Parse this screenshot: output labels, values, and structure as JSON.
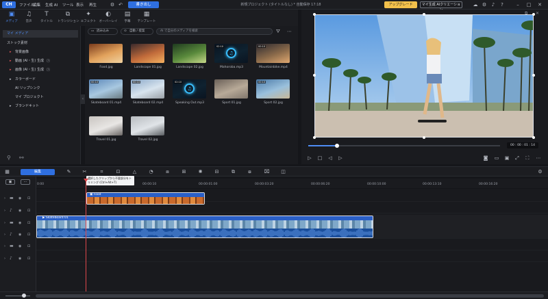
{
  "app": {
    "logo": "CH",
    "menus": [
      "ファイル",
      "編集",
      "生成 AI",
      "ツール",
      "表示",
      "再生"
    ],
    "export_label": "書き出し",
    "project_title": "新規プロジェクト (タイトルなし) * 自動保存 17:18",
    "upgrade_label": "アップグレード",
    "ai_label": "マイ生成 AIクリエーション"
  },
  "media_tabs": [
    {
      "label": "メディア",
      "icon": "media-icon",
      "glyph": "▣"
    },
    {
      "label": "音声",
      "icon": "music-icon",
      "glyph": "♫"
    },
    {
      "label": "タイトル",
      "icon": "title-icon",
      "glyph": "T"
    },
    {
      "label": "トランジション",
      "icon": "transition-icon",
      "glyph": "⧉"
    },
    {
      "label": "エフェクト",
      "icon": "effect-icon",
      "glyph": "✦"
    },
    {
      "label": "オーバーレイ",
      "icon": "overlay-icon",
      "glyph": "◐"
    },
    {
      "label": "字幕",
      "icon": "caption-icon",
      "glyph": "▤"
    },
    {
      "label": "テンプレート",
      "icon": "template-icon",
      "glyph": "▦"
    }
  ],
  "sidebar": {
    "items": [
      {
        "label": "マイ メディア",
        "active": true,
        "caret": false
      },
      {
        "label": "ストック素材",
        "active": false,
        "caret": false
      },
      {
        "label": "背景画像",
        "active": false,
        "caret": true
      },
      {
        "label": "動画 (AI・生) 生成",
        "active": false,
        "caret": true
      },
      {
        "label": "画像 (AI・生) 生成",
        "active": false,
        "caret": true
      },
      {
        "label": "カラーボード",
        "active": false,
        "caret": true
      },
      {
        "label": "AI リップシンク",
        "active": false,
        "caret": false
      },
      {
        "label": "マイ プロジェクト",
        "active": false,
        "caret": false
      },
      {
        "label": "ブランドキット",
        "active": false,
        "caret": true
      }
    ]
  },
  "filterbar": {
    "import_label": "読み込み",
    "download_label": "自動 / 提案",
    "search_placeholder": "AI で自分のメディアを検索"
  },
  "media_items": [
    {
      "label": "Food.jpg",
      "duration": "",
      "colors": [
        "#7a3b1c",
        "#e2a25c",
        "#f0d2a0"
      ]
    },
    {
      "label": "Landscape 01.jpg",
      "duration": "",
      "colors": [
        "#3a2a2c",
        "#c06a3a",
        "#f4b060"
      ]
    },
    {
      "label": "Landscape 02.jpg",
      "duration": "",
      "colors": [
        "#1f3b1f",
        "#5a8a3c",
        "#c7d98a"
      ]
    },
    {
      "label": "Mahoroba.mp3",
      "duration": "02:10",
      "colors": [
        "#0a1420",
        "#0f2230",
        "#0a1420"
      ],
      "music": true
    },
    {
      "label": "Mountainbike.mp4",
      "duration": "00:10",
      "colors": [
        "#2c2a30",
        "#8a6a4a",
        "#e0a870"
      ]
    },
    {
      "label": "Skateboard 01.mp4",
      "duration": "00:10",
      "colors": [
        "#5a86b8",
        "#a8c8e0",
        "#6a7a80"
      ]
    },
    {
      "label": "Skateboard 02.mp4",
      "duration": "00:10",
      "colors": [
        "#8aa8c8",
        "#d8e4ee",
        "#9aa0a6"
      ]
    },
    {
      "label": "Speaking Out.mp3",
      "duration": "02:10",
      "colors": [
        "#0a1420",
        "#0f2230",
        "#0a1420"
      ],
      "music": true
    },
    {
      "label": "Sport 01.jpg",
      "duration": "",
      "colors": [
        "#6a6058",
        "#b8aa98",
        "#80766c"
      ]
    },
    {
      "label": "Sport 02.jpg",
      "duration": "00:10",
      "colors": [
        "#4a7aa8",
        "#9ac0dc",
        "#c8b898"
      ]
    },
    {
      "label": "Travel 01.jpg",
      "duration": "",
      "colors": [
        "#c8c4c0",
        "#e8e6e4",
        "#6a6664"
      ]
    },
    {
      "label": "Travel 02.jpg",
      "duration": "",
      "colors": [
        "#b8bcc0",
        "#e0e4e8",
        "#5a5e62"
      ]
    }
  ],
  "preview": {
    "timecode": "00 : 00 : 01 : 14",
    "progress": 0.15
  },
  "timeline": {
    "edit_label": "編集",
    "tooltip": "選択したクリップから不要部分をトリミング (Ctrl+Alt+T)",
    "ruler_labels": [
      "0:00",
      "00:00:01:00",
      "00:00:03:20",
      "00:00:06:20",
      "00:00:10:00",
      "00:00:13:10",
      "00:00:16:20",
      "00:00:20:00",
      "00:00:23:10",
      "00:00:26:20"
    ],
    "ruler_labels_short": [
      "0:00",
      "00:00:01:00",
      "00:00:03:20",
      "00:00:06:20",
      "00:00:10:00",
      "00:00:13:10"
    ],
    "food_clip_label": "Food",
    "skate_clip_label": "Skateboard 01"
  },
  "colors": {
    "accent": "#2f6fe0",
    "playhead": "#e0484c",
    "upgrade": "#f2c04b"
  }
}
